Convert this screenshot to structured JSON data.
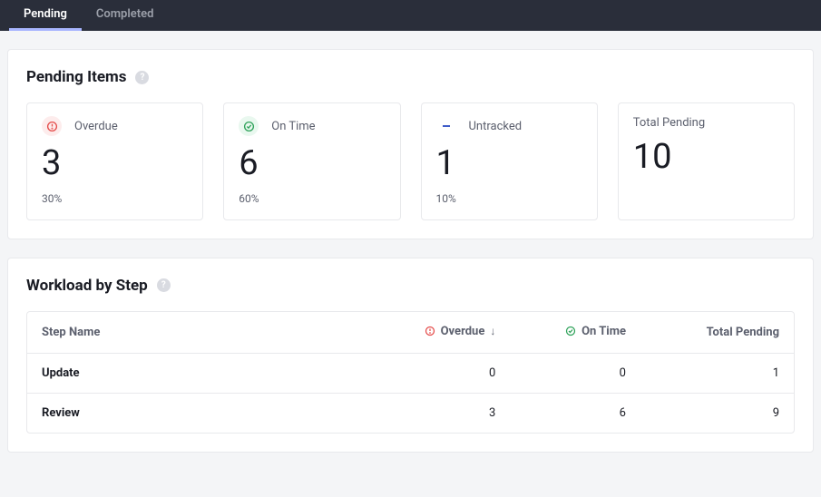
{
  "tabs": {
    "pending": "Pending",
    "completed": "Completed"
  },
  "pendingItems": {
    "title": "Pending Items",
    "cards": {
      "overdue": {
        "label": "Overdue",
        "value": "3",
        "sub": "30%"
      },
      "ontime": {
        "label": "On Time",
        "value": "6",
        "sub": "60%"
      },
      "untracked": {
        "label": "Untracked",
        "value": "1",
        "sub": "10%"
      },
      "total": {
        "label": "Total Pending",
        "value": "10"
      }
    }
  },
  "workload": {
    "title": "Workload by Step",
    "columns": {
      "step": "Step Name",
      "overdue": "Overdue",
      "ontime": "On Time",
      "total": "Total Pending"
    },
    "rows": [
      {
        "step": "Update",
        "overdue": "0",
        "ontime": "0",
        "total": "1"
      },
      {
        "step": "Review",
        "overdue": "3",
        "ontime": "6",
        "total": "9"
      }
    ]
  }
}
